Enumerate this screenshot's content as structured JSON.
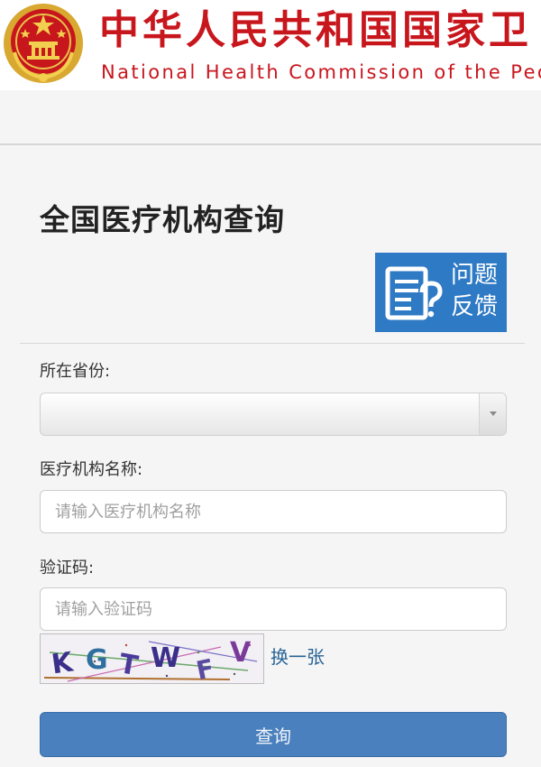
{
  "header": {
    "title": "中华人民共和国国家卫",
    "subtitle": "National Health Commission of the Peo",
    "emblem_icon": "national-emblem-icon",
    "title_color": "#c8161d"
  },
  "page": {
    "title": "全国医疗机构查询"
  },
  "feedback": {
    "label_line1": "问题",
    "label_line2": "反馈",
    "icon": "document-question-icon",
    "color": "#2f7ac4"
  },
  "form": {
    "province": {
      "label": "所在省份:",
      "selected_value": ""
    },
    "institution_name": {
      "label": "医疗机构名称:",
      "value": "",
      "placeholder": "请输入医疗机构名称"
    },
    "captcha": {
      "label": "验证码:",
      "value": "",
      "placeholder": "请输入验证码",
      "image_text": "KGTWFV",
      "refresh_label": "换一张"
    },
    "submit_label": "查询",
    "submit_color": "#4a80bd"
  }
}
